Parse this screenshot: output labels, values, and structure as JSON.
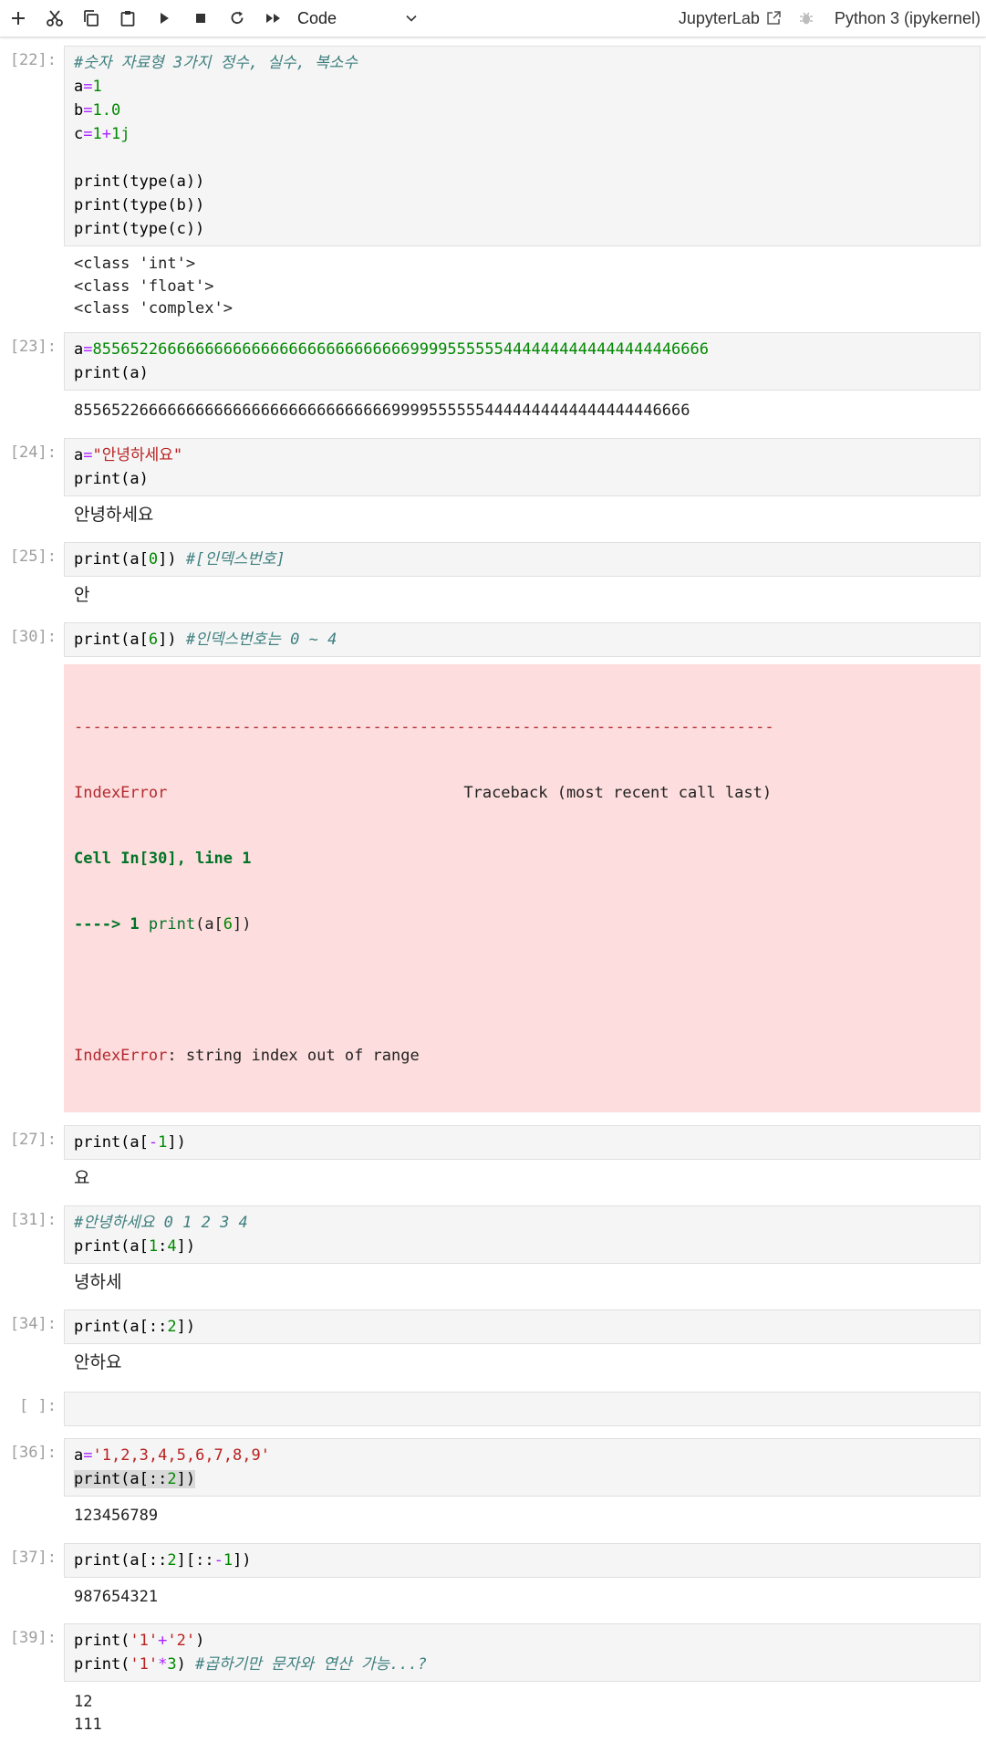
{
  "toolbar": {
    "cell_type": "Code",
    "jupyterlab_label": "JupyterLab",
    "kernel_name": "Python 3 (ipykernel)"
  },
  "cells": [
    {
      "prompt": "[22]:",
      "input": [
        "#숫자 자료형 3가지 정수, 실수, 복소수",
        "a=1",
        "b=1.0",
        "c=1+1j",
        "",
        "print(type(a))",
        "print(type(b))",
        "print(type(c))"
      ],
      "output": [
        "<class 'int'>",
        "<class 'float'>",
        "<class 'complex'>"
      ]
    },
    {
      "prompt": "[23]:",
      "input": [
        "a=855652266666666666666666666666666699995555554444444444444444446666",
        "print(a)"
      ],
      "output": [
        "855652266666666666666666666666666699995555554444444444444444446666"
      ]
    },
    {
      "prompt": "[24]:",
      "input": [
        "a=\"안녕하세요\"",
        "print(a)"
      ],
      "output": [
        "안녕하세요"
      ]
    },
    {
      "prompt": "[25]:",
      "input": [
        "print(a[0]) #[인덱스번호]"
      ],
      "output": [
        "안"
      ]
    },
    {
      "prompt": "[30]:",
      "input": [
        "print(a[6]) #인덱스번호는 0 ~ 4"
      ],
      "error": {
        "dashes": "---------------------------------------------------------------------------",
        "name": "IndexError",
        "traceback_header": "Traceback (most recent call last)",
        "cell_ref": "Cell In[30], line 1",
        "arrow_line": "----> 1 print(a[6])",
        "message": "string index out of range"
      }
    },
    {
      "prompt": "[27]:",
      "input": [
        "print(a[-1])"
      ],
      "output": [
        "요"
      ]
    },
    {
      "prompt": "[31]:",
      "input": [
        "#안녕하세요 0 1 2 3 4",
        "print(a[1:4])"
      ],
      "output": [
        "녕하세"
      ]
    },
    {
      "prompt": "[34]:",
      "input": [
        "print(a[::2])"
      ],
      "output": [
        "안하요"
      ]
    },
    {
      "prompt": "[ ]:",
      "input": [
        ""
      ]
    },
    {
      "prompt": "[36]:",
      "input": [
        "a='1,2,3,4,5,6,7,8,9'",
        "print(a[::2])"
      ],
      "output": [
        "123456789"
      ]
    },
    {
      "prompt": "[37]:",
      "input": [
        "print(a[::2][::-1])"
      ],
      "output": [
        "987654321"
      ]
    },
    {
      "prompt": "[39]:",
      "input": [
        "print('1'+'2')",
        "print('1'*3) #곱하기만 문자와 연산 가능...?"
      ],
      "output": [
        "12",
        "111"
      ]
    }
  ]
}
